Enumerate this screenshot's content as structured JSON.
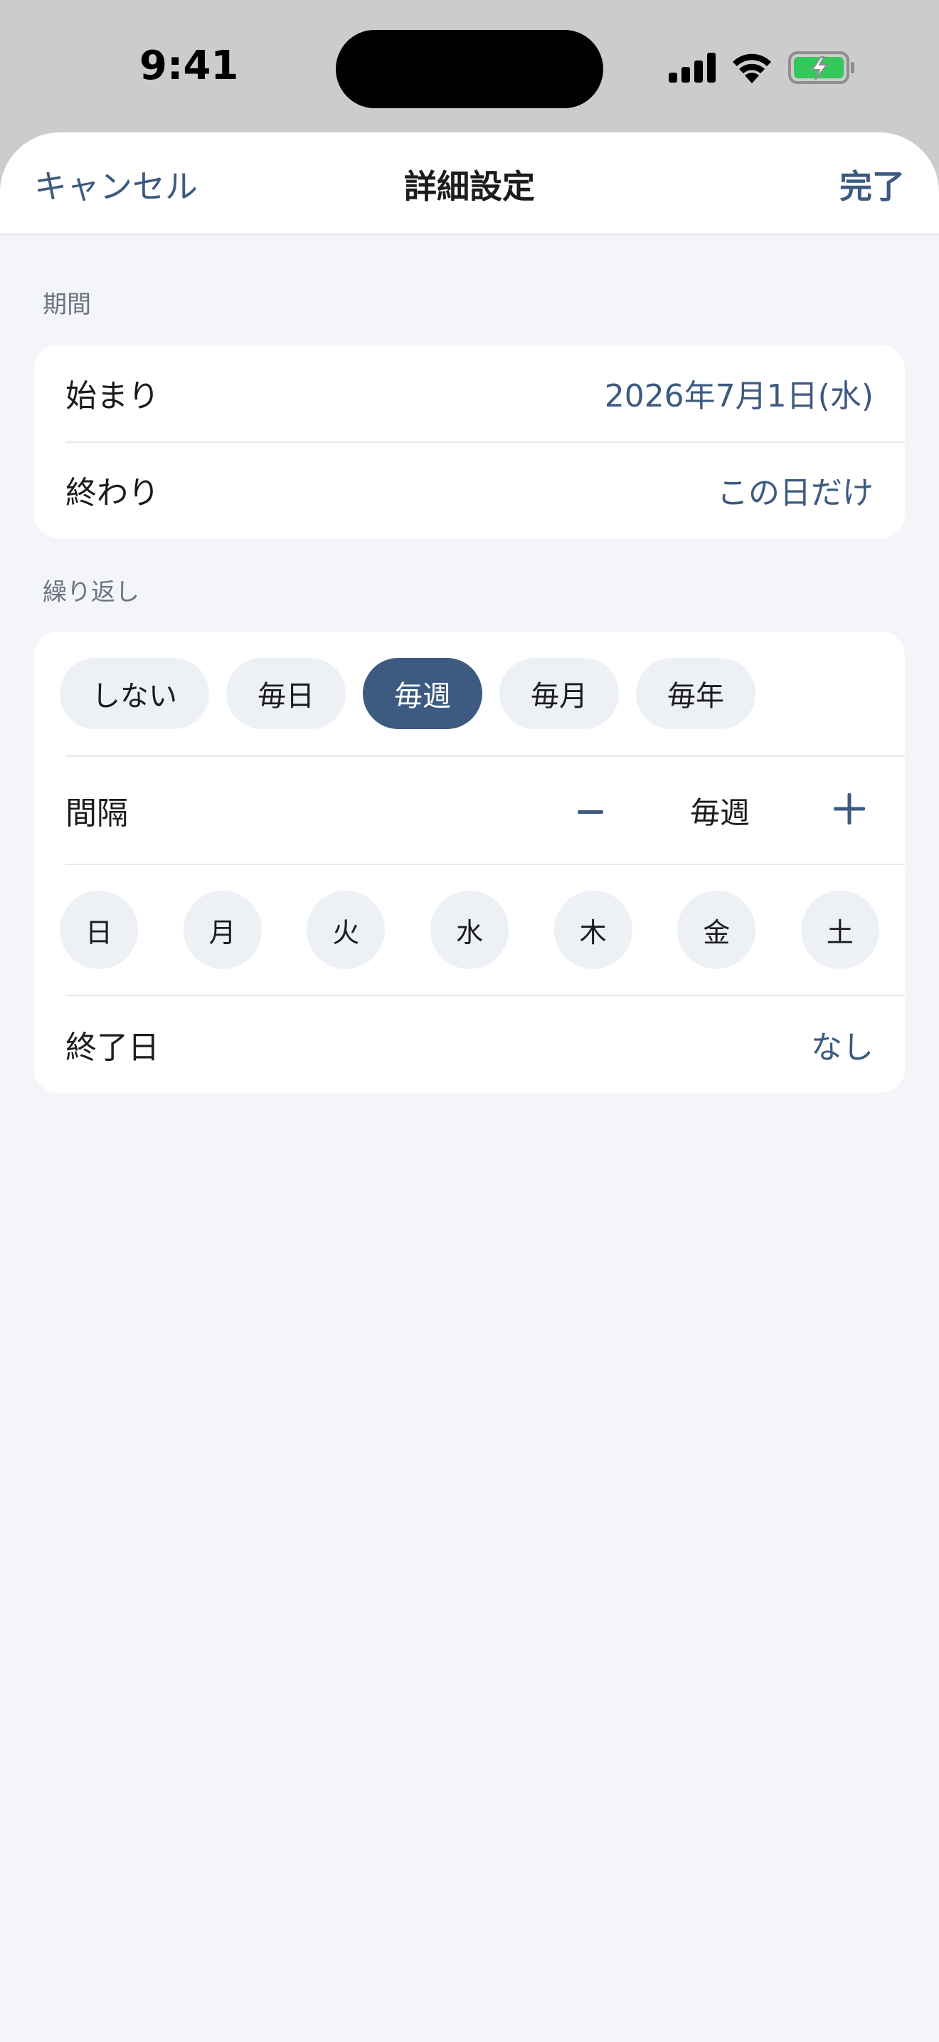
{
  "status_bar": {
    "time": "9:41"
  },
  "nav": {
    "cancel_label": "キャンセル",
    "title": "詳細設定",
    "done_label": "完了"
  },
  "period": {
    "section_label": "期間",
    "start_label": "始まり",
    "start_value": "2026年7月1日(水)",
    "end_label": "終わり",
    "end_value": "この日だけ"
  },
  "repeat": {
    "section_label": "繰り返し",
    "options": [
      "しない",
      "毎日",
      "毎週",
      "毎月",
      "毎年"
    ],
    "selected": "毎週",
    "interval_label": "間隔",
    "interval_value": "毎週",
    "days": [
      "日",
      "月",
      "火",
      "水",
      "木",
      "金",
      "土"
    ],
    "end_date_label": "終了日",
    "end_date_value": "なし"
  },
  "colors": {
    "accent": "#3d5a80",
    "background": "#f3f5f8",
    "pill": "#edf0f4",
    "battery_green": "#34c759"
  },
  "icons": [
    "signal-icon",
    "wifi-icon",
    "battery-charging-icon",
    "minus-icon",
    "plus-icon"
  ]
}
